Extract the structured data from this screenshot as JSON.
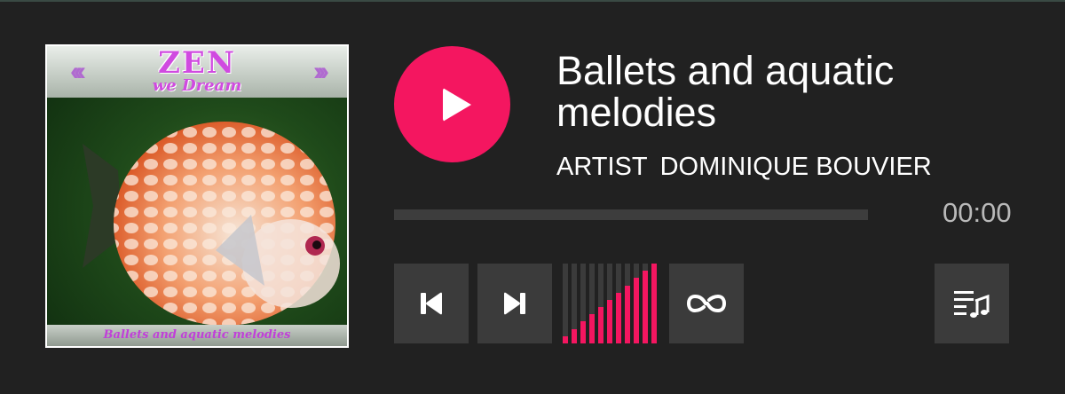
{
  "album": {
    "cover_logo": "ZEN",
    "cover_logo_sub": "we Dream",
    "cover_caption": "Ballets and aquatic melodies"
  },
  "track": {
    "title": "Ballets and aquatic melodies",
    "artist_label": "ARTIST",
    "artist_name": "DOMINIQUE BOUVIER",
    "time": "00:00",
    "progress": 0
  },
  "controls": {
    "play_icon": "play-icon",
    "prev_icon": "skip-previous-icon",
    "next_icon": "skip-next-icon",
    "loop_icon": "loop-icon",
    "playlist_icon": "playlist-music-icon"
  },
  "volume": {
    "level_fraction": 1.0,
    "bars": 11
  },
  "colors": {
    "accent": "#f41660",
    "background": "#212121",
    "button": "#3b3b3b",
    "track": "#3d3d3d",
    "time_text": "#b9b9b9"
  }
}
